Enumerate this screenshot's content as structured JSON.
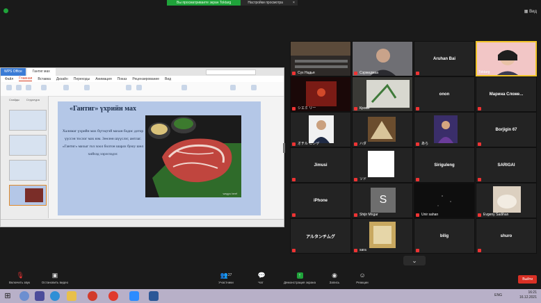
{
  "banner": {
    "sharing": "Вы просматриваете экран Toktarg",
    "view_options": "Настройки просмотра",
    "close": "×"
  },
  "view": {
    "label": "Вид"
  },
  "ppt": {
    "tab_app": "WPS Office",
    "tab_doc": "Гантиг мах",
    "menu": [
      "Файл",
      "Главная",
      "Вставка",
      "Дизайн",
      "Переходы",
      "Анимация",
      "Показ",
      "Рецензирование",
      "Вид"
    ],
    "pane_tabs": [
      "Слайды",
      "Структура"
    ],
    "slide_title": "«Гантиг» үхрийн мах",
    "slide_body": "Халимаг үхрийн мах бүтэцтэй махан бодис дотор үүссэн тослог мах юм. Зөөлөн шүүслэг, амтлаг. «Гантиг» махыг гол хоол болгон шарах буюу шөл хийхэд хэрэглэдэг.",
    "img_caption": "wagyu beef"
  },
  "gallery": [
    {
      "name": "Сүх Надья",
      "type": "photo"
    },
    {
      "name": "Сэржидмаа",
      "type": "photo"
    },
    {
      "name": "Aruhan Bai",
      "type": "name"
    },
    {
      "name": "Toktarg",
      "type": "photo",
      "speaking": true
    },
    {
      "name": "シエミ リー",
      "type": "photo"
    },
    {
      "name": "Кроме",
      "type": "photo"
    },
    {
      "name": "onon",
      "type": "name"
    },
    {
      "name": "Марина Сложе...",
      "type": "name"
    },
    {
      "name": "オチル ヒシゲ",
      "type": "photo"
    },
    {
      "name": "ハダ",
      "type": "photo"
    },
    {
      "name": "あら",
      "type": "photo"
    },
    {
      "name": "Borjigin 67",
      "type": "name"
    },
    {
      "name": "Jimusi",
      "type": "name"
    },
    {
      "name": "ソド",
      "type": "photo"
    },
    {
      "name": "Siriguleng",
      "type": "name"
    },
    {
      "name": "SARIGAI",
      "type": "name"
    },
    {
      "name": "iPhone",
      "type": "name"
    },
    {
      "name": "Shijir Mngar",
      "type": "avatar",
      "avatar": "S"
    },
    {
      "name": "Unir sahan",
      "type": "photo"
    },
    {
      "name": "Evgeny Sadihan",
      "type": "photo"
    },
    {
      "name": "アルタンチムグ",
      "type": "name"
    },
    {
      "name": "sara",
      "type": "photo"
    },
    {
      "name": "bilig",
      "type": "name"
    },
    {
      "name": "shuro",
      "type": "name"
    }
  ],
  "toolbar": {
    "mic": "Включить звук",
    "video": "Остановить видео",
    "participants": "Участники",
    "participants_count": "27",
    "chat": "Чат",
    "share": "Демонстрация экрана",
    "record": "Запись",
    "reactions": "Реакции",
    "leave": "Выйти"
  },
  "taskbar": {
    "time": "16:21",
    "date": "16.12.2021",
    "lang": "ENG"
  },
  "colors": {
    "speaking": "#f0c428",
    "share_green": "#1fa33a",
    "leave_red": "#d93025"
  }
}
